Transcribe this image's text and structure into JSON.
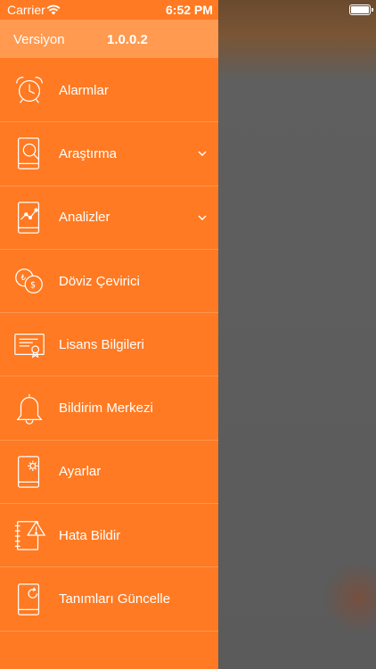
{
  "statusbar": {
    "carrier": "Carrier",
    "time": "6:52 PM"
  },
  "header": {
    "version_label": "Versiyon",
    "version_value": "1.0.0.2"
  },
  "menu": [
    {
      "label": "Alarmlar",
      "icon": "alarm-clock-icon",
      "expandable": false
    },
    {
      "label": "Araştırma",
      "icon": "phone-search-icon",
      "expandable": true
    },
    {
      "label": "Analizler",
      "icon": "phone-analysis-icon",
      "expandable": true
    },
    {
      "label": "Döviz Çevirici",
      "icon": "currency-exchange-icon",
      "expandable": false
    },
    {
      "label": "Lisans Bilgileri",
      "icon": "license-certificate-icon",
      "expandable": false
    },
    {
      "label": "Bildirim Merkezi",
      "icon": "bell-icon",
      "expandable": false
    },
    {
      "label": "Ayarlar",
      "icon": "phone-settings-icon",
      "expandable": false
    },
    {
      "label": "Hata Bildir",
      "icon": "notebook-warning-icon",
      "expandable": false
    },
    {
      "label": "Tanımları Güncelle",
      "icon": "phone-refresh-icon",
      "expandable": false
    }
  ],
  "colors": {
    "drawer": "#ff7a22",
    "version_bar": "#ff9a50",
    "overlay": "#5b5b5b",
    "text": "#ffffff"
  }
}
